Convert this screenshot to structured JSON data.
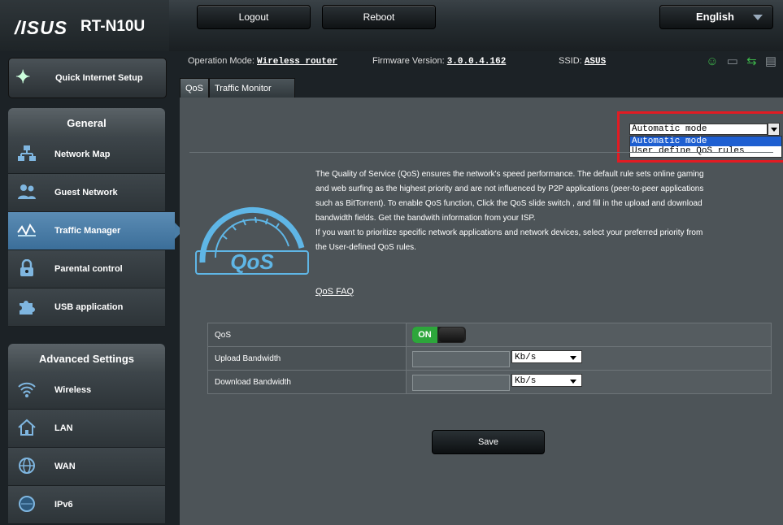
{
  "header": {
    "logo_text": "/ISUS",
    "model": "RT-N10U",
    "logout_label": "Logout",
    "reboot_label": "Reboot",
    "language": "English"
  },
  "sidebar": {
    "quick_setup_label": "Quick Internet Setup",
    "general_title": "General",
    "general_items": [
      {
        "label": "Network Map"
      },
      {
        "label": "Guest Network"
      },
      {
        "label": "Traffic Manager"
      },
      {
        "label": "Parental control"
      },
      {
        "label": "USB application"
      }
    ],
    "advanced_title": "Advanced Settings",
    "advanced_items": [
      {
        "label": "Wireless"
      },
      {
        "label": "LAN"
      },
      {
        "label": "WAN"
      },
      {
        "label": "IPv6"
      }
    ]
  },
  "status": {
    "op_mode_label": "Operation Mode:",
    "op_mode_value": "Wireless router",
    "firmware_label": "Firmware Version:",
    "firmware_value": "3.0.0.4.162",
    "ssid_label": "SSID:",
    "ssid_value": "ASUS"
  },
  "tabs": [
    {
      "label": "QoS"
    },
    {
      "label": "Traffic Monitor"
    }
  ],
  "mode_select": {
    "selected": "Automatic mode",
    "options": [
      "Automatic mode",
      "User define QoS rules"
    ]
  },
  "description": {
    "paragraph1": "The Quality of Service (QoS) ensures the network's speed performance. The default rule sets online gaming and web surfing as the highest priority and are not influenced by P2P applications (peer-to-peer applications such as BitTorrent). To enable QoS function, Click the QoS slide switch , and fill in the upload and download bandwidth fields. Get the bandwith information from your ISP.",
    "paragraph2": "If you want to prioritize specific network applications and network devices, select your preferred priority from the User-defined QoS rules.",
    "faq_link": "QoS FAQ",
    "emblem_text": "QoS"
  },
  "settings": {
    "qos_label": "QoS",
    "qos_state": "ON",
    "upload_label": "Upload Bandwidth",
    "upload_unit": "Kb/s",
    "download_label": "Download Bandwidth",
    "download_unit": "Kb/s",
    "save_label": "Save"
  },
  "colors": {
    "accent_blue": "#4a7da6",
    "toggle_on": "#2da63b",
    "highlight_red": "#e21b23"
  }
}
